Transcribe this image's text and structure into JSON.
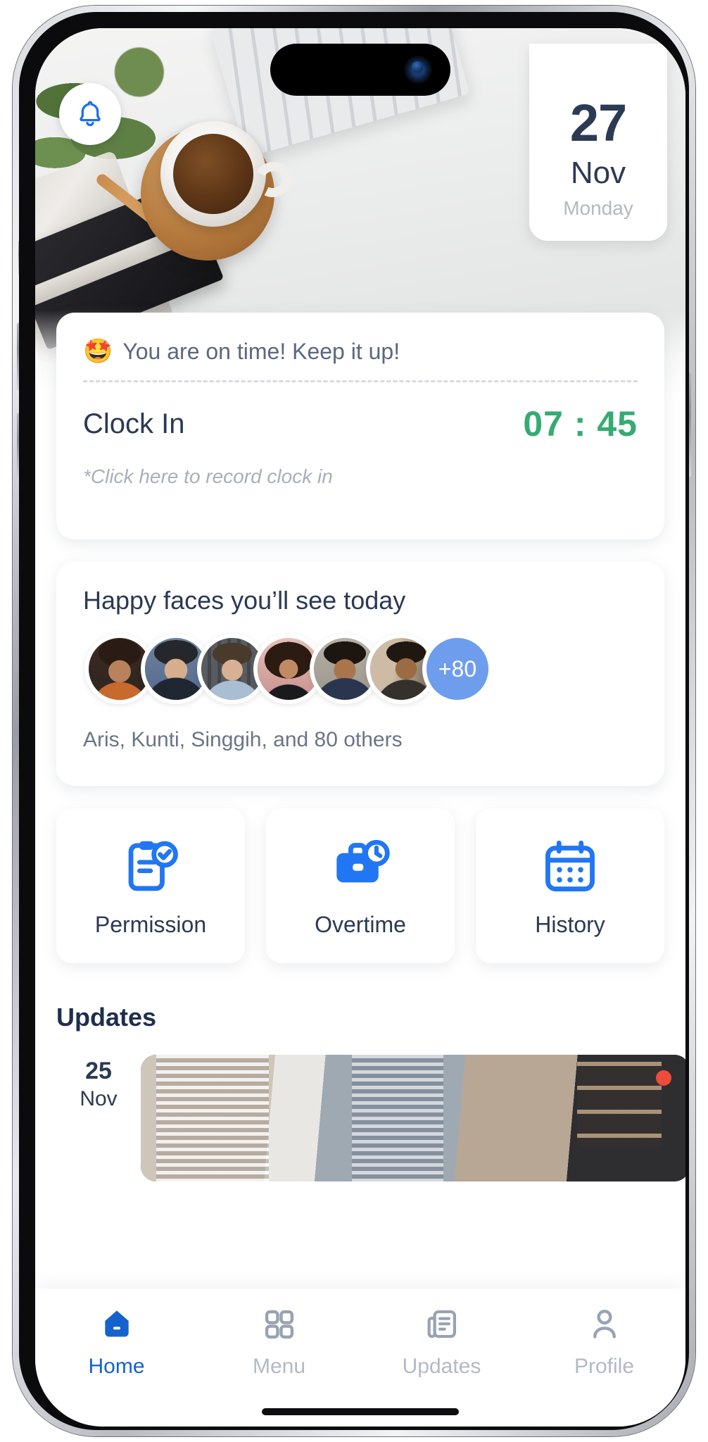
{
  "header": {
    "bell_icon": "bell-icon",
    "date": {
      "day": "27",
      "month": "Nov",
      "weekday": "Monday"
    }
  },
  "clock_in_card": {
    "status_emoji": "🤩",
    "status_text": "You are on time! Keep it up!",
    "label": "Clock In",
    "time": "07 : 45",
    "hint": "*Click here to record clock in",
    "time_color": "#35ab72"
  },
  "faces_card": {
    "title": "Happy faces you’ll see today",
    "avatars": [
      {
        "name": "avatar-1",
        "skin": "#b9825c",
        "hair": "#2a1c14",
        "shirt": "#c86a2e",
        "bg": "#2e2520"
      },
      {
        "name": "avatar-2",
        "skin": "#d7ae8d",
        "hair": "#26272b",
        "shirt": "#1f2733",
        "bg": "#5c6f8e"
      },
      {
        "name": "avatar-3",
        "skin": "#d9b094",
        "hair": "#4a3a2c",
        "shirt": "#a9bed4",
        "bg": "#4c5055"
      },
      {
        "name": "avatar-4",
        "skin": "#c08a63",
        "hair": "#2b1b12",
        "shirt": "#1a1a1c",
        "bg": "#d9b3ae"
      },
      {
        "name": "avatar-5",
        "skin": "#a9764b",
        "hair": "#1d1510",
        "shirt": "#2a3550",
        "bg": "#a9a39a"
      },
      {
        "name": "avatar-6",
        "skin": "#9b6b44",
        "hair": "#201711",
        "shirt": "#34302c",
        "bg": "#8a7a68"
      }
    ],
    "more_badge": "+80",
    "more_badge_color": "#6e9ded",
    "names_summary": "Aris, Kunti, Singgih, and 80 others"
  },
  "quick_actions": [
    {
      "label": "Permission",
      "icon": "clipboard-check-icon",
      "color": "#2176f3"
    },
    {
      "label": "Overtime",
      "icon": "briefcase-clock-icon",
      "color": "#2176f3"
    },
    {
      "label": "History",
      "icon": "calendar-icon",
      "color": "#2176f3"
    }
  ],
  "updates": {
    "title": "Updates",
    "items": [
      {
        "day": "25",
        "month": "Nov",
        "badge_color": "#ef4b3c"
      }
    ]
  },
  "tabbar": {
    "items": [
      {
        "label": "Home",
        "icon": "home-icon",
        "active": true
      },
      {
        "label": "Menu",
        "icon": "grid-icon",
        "active": false
      },
      {
        "label": "Updates",
        "icon": "document-icon",
        "active": false
      },
      {
        "label": "Profile",
        "icon": "person-icon",
        "active": false
      }
    ],
    "active_color": "#1463cc",
    "inactive_color": "#b3bac6"
  }
}
